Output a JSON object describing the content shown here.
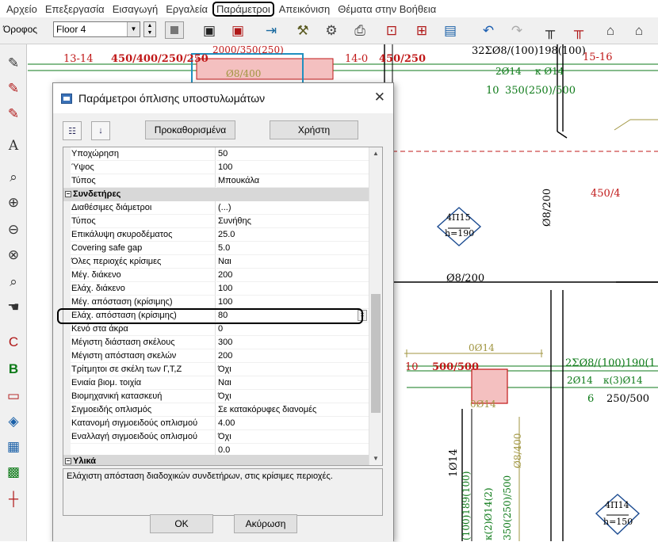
{
  "menu": [
    "Αρχείο",
    "Επεξεργασία",
    "Εισαγωγή",
    "Εργαλεία",
    "Παράμετροι",
    "Απεικόνιση",
    "Θέματα στην Βοήθεια"
  ],
  "active_menu": "Παράμετροι",
  "toolbar": {
    "floor_label": "Όροφος",
    "floor_value": "Floor 4"
  },
  "icons": {
    "save": "save-icon",
    "save_as": "save-as-icon",
    "import": "import-icon",
    "tools": "tools-icon",
    "print": "print-icon",
    "undo": "undo-icon",
    "redo": "redo-icon"
  },
  "drawing": {
    "labels_red": [
      "13-14",
      "450/400/250/250",
      "14-0",
      "450/250",
      "15-16",
      "450/4",
      "10",
      "500/500"
    ],
    "labels_green": [
      "2Ø14",
      "κ Ø14",
      "10",
      "350(250)/500",
      "2Ø14",
      "κ(3)Ø14",
      "6",
      "250/500",
      "2ΣØ8/(100)190(1"
    ],
    "labels_black": [
      "32ΣØ8/(100)198(100)",
      "Ø8/200",
      "Ø8/200",
      "1Ø14",
      "(100)189(100)",
      "κ(2)Ø14(2)",
      "350(250)/500",
      "15",
      "190",
      "14",
      "150",
      "0Ø14",
      "0Ø14",
      "0Ø14",
      "Ø8/400"
    ],
    "col_labels": {
      "c15": "4Π15",
      "c15_h": "h=190",
      "c14": "4Π14",
      "c14_h": "h=150"
    },
    "top_labels": [
      "2000/350(250)",
      "32ΣØ8/(100)198(100)",
      "Ø8/400"
    ]
  },
  "dialog": {
    "title": "Παράμετροι όπλισης υποστυλωμάτων",
    "btn_defaults": "Προκαθορισμένα",
    "btn_user": "Χρήστη",
    "properties_top": [
      {
        "key": "Υποχώρηση",
        "value": "50"
      },
      {
        "key": "Ύψος",
        "value": "100"
      },
      {
        "key": "Τύπος",
        "value": "Μπουκάλα"
      }
    ],
    "category_ties": "Συνδετήρες",
    "properties_ties": [
      {
        "key": "Διαθέσιμες διάμετροι",
        "value": "(...)"
      },
      {
        "key": "Τύπος",
        "value": "Συνήθης"
      },
      {
        "key": "Επικάλυψη σκυροδέματος",
        "value": "25.0"
      },
      {
        "key": "Covering safe gap",
        "value": "5.0"
      },
      {
        "key": "Όλες περιοχές κρίσιμες",
        "value": "Ναι"
      },
      {
        "key": "Μέγ. διάκενο",
        "value": "200"
      },
      {
        "key": "Ελάχ. διάκενο",
        "value": "100"
      },
      {
        "key": "Μέγ. απόσταση (κρίσιμης)",
        "value": "100"
      },
      {
        "key": "Ελάχ. απόσταση (κρίσιμης)",
        "value": "80"
      },
      {
        "key": "Κενό στα άκρα",
        "value": "0"
      },
      {
        "key": "Μέγιστη διάσταση σκέλους",
        "value": "300"
      },
      {
        "key": "Μέγιστη απόσταση σκελών",
        "value": "200"
      },
      {
        "key": "Τρίτμητοι σε σκέλη των Γ,Τ,Ζ",
        "value": "Όχι"
      },
      {
        "key": "Ενιαία βιομ. τοιχία",
        "value": "Ναι"
      },
      {
        "key": "Βιομηχανική κατασκευή",
        "value": "Όχι"
      },
      {
        "key": "Σιγμοειδής οπλισμός",
        "value": "Σε κατακόρυφες διανομές"
      },
      {
        "key": "Κατανομή σιγμοειδούς οπλισμού",
        "value": "4.00"
      },
      {
        "key": "Εναλλαγή σιγμοειδούς οπλισμού",
        "value": "Όχι"
      },
      {
        "key": "",
        "value": "0.0"
      }
    ],
    "category_materials": "Υλικά",
    "description": "Ελάχιστη απόσταση διαδοχικών συνδετήρων, στις κρίσιμες περιοχές.",
    "ok": "OK",
    "cancel": "Ακύρωση"
  }
}
